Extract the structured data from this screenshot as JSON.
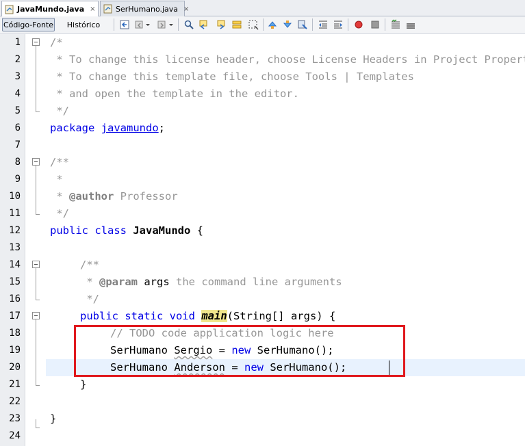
{
  "tabs": [
    {
      "label": "JavaMundo.java",
      "active": true,
      "close": "×"
    },
    {
      "label": "SerHumano.java",
      "active": false,
      "close": "×"
    }
  ],
  "toolbar": {
    "codigo_label": "Código-Fonte",
    "historico_label": "Histórico"
  },
  "editor": {
    "line_numbers": [
      "1",
      "2",
      "3",
      "4",
      "5",
      "6",
      "7",
      "8",
      "9",
      "10",
      "11",
      "12",
      "13",
      "14",
      "15",
      "16",
      "17",
      "18",
      "19",
      "20",
      "21",
      "22",
      "23",
      "24"
    ],
    "l1": "/*",
    "l2": " * To change this license header, choose License Headers in Project Properties.",
    "l3": " * To change this template file, choose Tools | Templates",
    "l4": " * and open the template in the editor.",
    "l5": " */",
    "l6_kw": "package",
    "l6_pkg": "javamundo",
    "l6_end": ";",
    "l8": "/**",
    "l9": " *",
    "l10_a": " * ",
    "l10_tag": "@author",
    "l10_b": " Professor",
    "l11": " */",
    "l12_kw": "public class",
    "l12_name": "JavaMundo",
    "l12_end": " {",
    "l14": "/**",
    "l15_a": " * ",
    "l15_tag": "@param",
    "l15_arg": " args",
    "l15_b": " the command line arguments",
    "l16": " */",
    "l17_kw": "public static void",
    "l17_main": "main",
    "l17_rest": "(String[] args) {",
    "l18": "// TODO code application logic here",
    "l19_type": "SerHumano ",
    "l19_var": "Sergio",
    "l19_eq": " = ",
    "l19_new": "new",
    "l19_rest": " SerHumano();",
    "l20_type": "SerHumano ",
    "l20_var": "Anderson",
    "l20_eq": " = ",
    "l20_new": "new",
    "l20_rest": " SerHumano();",
    "l21": "}",
    "l23": "}"
  },
  "colors": {
    "keyword": "#0000E6",
    "comment": "#969696",
    "highlight_box": "#E0191E",
    "method_highlight": "#F0E68C"
  }
}
